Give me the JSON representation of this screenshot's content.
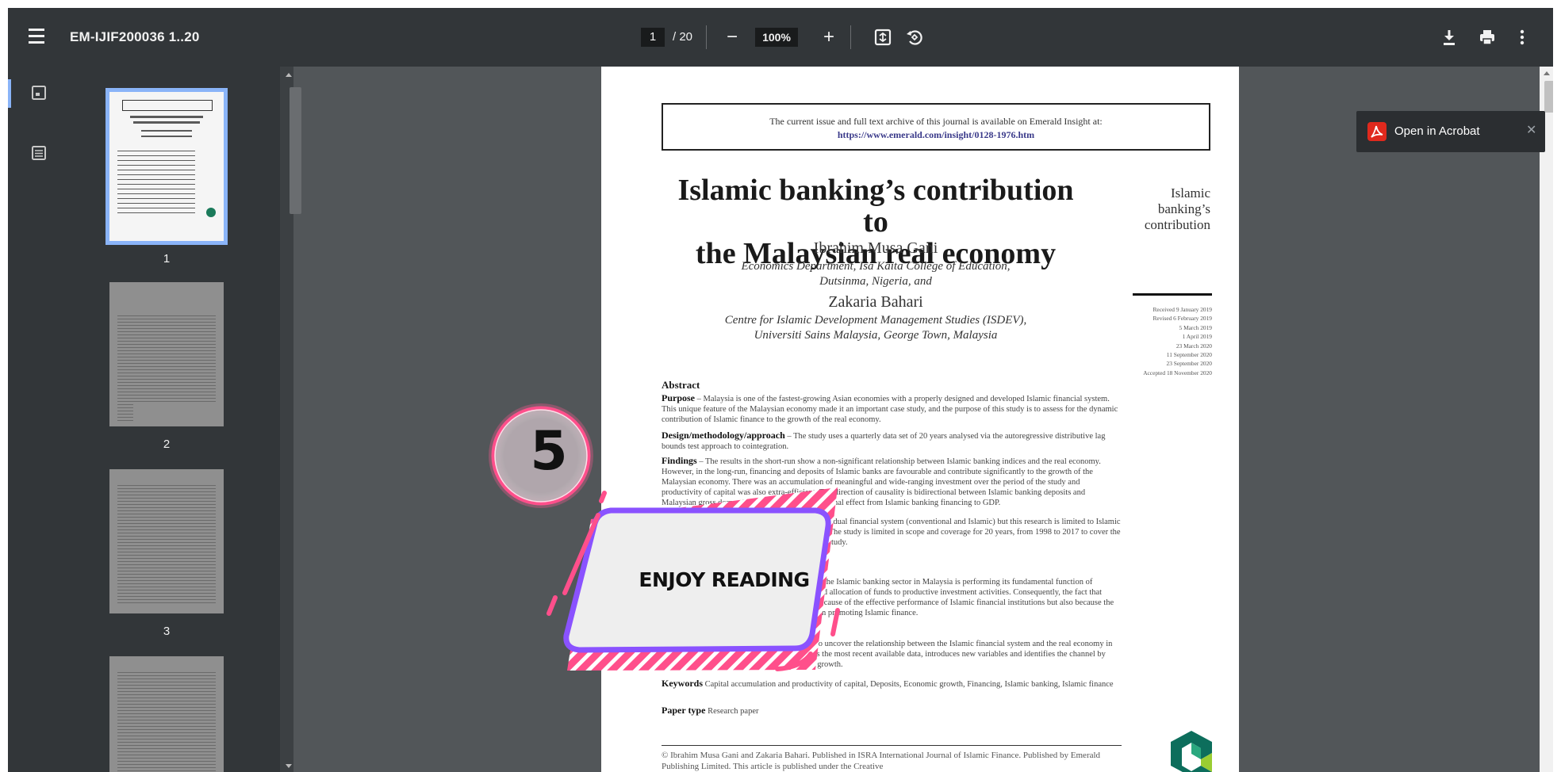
{
  "toolbar": {
    "title": "EM-IJIF200036 1..20",
    "page_current": "1",
    "page_total": "/ 20",
    "zoom_out_symbol": "−",
    "zoom": "100%",
    "zoom_in_symbol": "+"
  },
  "sidebar": {
    "thumbnails": [
      {
        "page": "1"
      },
      {
        "page": "2"
      },
      {
        "page": "3"
      }
    ]
  },
  "doc": {
    "notice_line1": "The current issue and full text archive of this journal is available on Emerald Insight at:",
    "notice_url": "https://www.emerald.com/insight/0128-1976.htm",
    "title_line1": "Islamic banking’s contribution to",
    "title_line2": "the Malaysian real economy",
    "margin_title_1": "Islamic",
    "margin_title_2": "banking’s",
    "margin_title_3": "contribution",
    "author1": "Ibrahim Musa Gani",
    "aff1_line1": "Economics Department, Isa Kaita College of Education,",
    "aff1_line2": "Dutsinma, Nigeria, and",
    "author2": "Zakaria Bahari",
    "aff2_line1": "Centre for Islamic Development Management Studies (ISDEV),",
    "aff2_line2": "Universiti Sains Malaysia, George Town, Malaysia",
    "dates": [
      "Received 9 January 2019",
      "Revised 6 February 2019",
      "5 March 2019",
      "1 April 2019",
      "23 March 2020",
      "11 September 2020",
      "23 September 2020",
      "Accepted 18 November 2020"
    ],
    "abstract_heading": "Abstract",
    "purpose_label": "Purpose",
    "purpose_text": " – Malaysia is one of the fastest-growing Asian economies with a properly designed and developed Islamic financial system. This unique feature of the Malaysian economy made it an important case study, and the purpose of this study is to assess for the dynamic contribution of Islamic finance to the growth of the real economy.",
    "design_label": "Design/methodology/approach",
    "design_text": " – The study uses a quarterly data set of 20 years analysed via the autoregressive distributive lag bounds test approach to cointegration.",
    "findings_label": "Findings",
    "findings_text": " – The results in the short-run show a non-significant relationship between Islamic banking indices and the real economy. However, in the long-run, financing and deposits of Islamic banks are favourable and contribute significantly to the growth of the Malaysian economy. There was an accumulation of meaningful and wide-ranging investment over the period of the study and productivity of capital was also extra-efficient. The direction of causality is bidirectional between Islamic banking deposits and Malaysian gross domestic product and a unidirectional effect from Islamic banking financing to GDP.",
    "limits_text": "Research limitations/implications – Malaysia has a dual financial system (conventional and Islamic) but this research is limited to Islamic banking's effects on Malaysian economic growth. The study is limited in scope and coverage for 20 years, from 1998 to 2017 to cover the availability of data of all the variables used in the study.",
    "practical_text": "Practical implications – The results confirm that the Islamic banking sector in Malaysia is performing its fundamental function of financial intermediation, which is the pooling and allocation of funds to productive investment activities. Consequently, the fact that Malaysia excels in Islamic finance is not only because of the effective performance of Islamic financial institutions but also because the regulatory authorities are doing their level best in promoting Islamic finance.",
    "original_text": "Originality/value – This paper fulfils the need to uncover the relationship between the Islamic financial system and the real economy in Malaysia. It differs from other studies as it uses the most recent available data, introduces new variables and identifies the channel by which Islamic banking development transmits growth.",
    "keywords_label": "Keywords",
    "keywords_text": " Capital accumulation and productivity of capital, Deposits, Economic growth, Financing, Islamic banking, Islamic finance",
    "papertype_label": "Paper type",
    "papertype_text": " Research paper",
    "copyright": "© Ibrahim Musa Gani and Zakaria Bahari. Published in ISRA International Journal of Islamic Finance. Published by Emerald Publishing Limited. This article is published under the Creative"
  },
  "acrobat": {
    "label": "Open in Acrobat"
  },
  "overlay": {
    "badge_number": "5",
    "banner_text": "ENJOY READING"
  },
  "colors": {
    "toolbar": "#323639",
    "viewer_bg": "#525659",
    "accent_blue": "#8ab4f8",
    "overlay_pink": "#ff4f8b",
    "overlay_purple": "#8a52ff"
  }
}
